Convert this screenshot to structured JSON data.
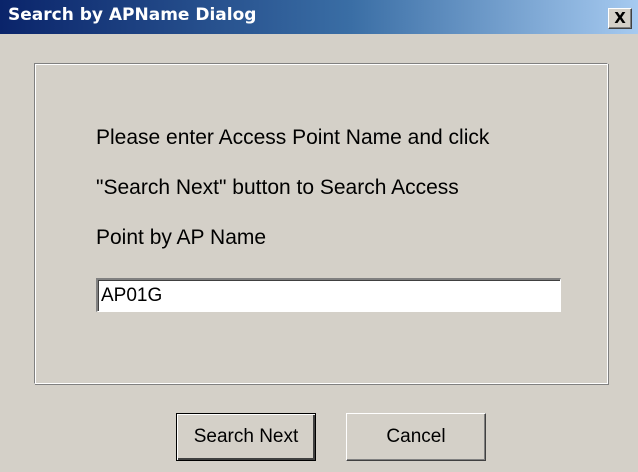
{
  "window": {
    "title": "Search by APName Dialog",
    "close_glyph": "X"
  },
  "instructions": {
    "line1": "Please enter Access Point Name and click",
    "line2": "\"Search Next\" button to Search Access",
    "line3": "Point by AP Name"
  },
  "ap_name_input": {
    "value": "AP01G"
  },
  "buttons": {
    "search_next": "Search Next",
    "cancel": "Cancel"
  },
  "colors": {
    "face": "#d4d0c8",
    "title_start": "#0a246a",
    "title_end": "#a6caf0"
  },
  "icons": {
    "close": "close-icon"
  }
}
